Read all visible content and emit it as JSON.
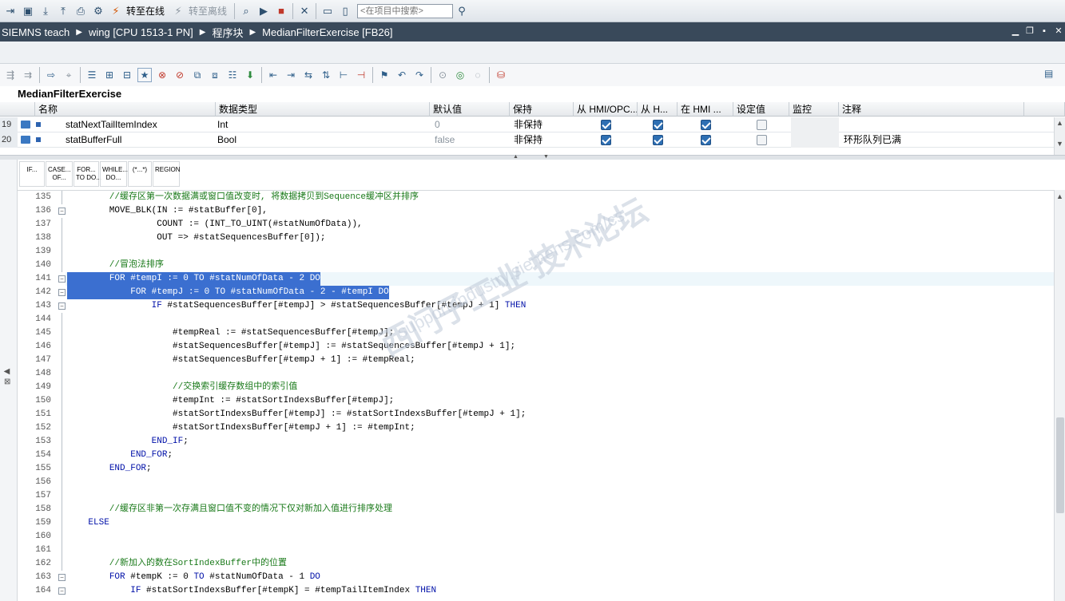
{
  "toolbar": {
    "go_online": "转至在线",
    "go_offline": "转至离线",
    "search_placeholder": "<在项目中搜索>"
  },
  "titlebar": {
    "crumbs": [
      "SIEMNS teach",
      "wing [CPU 1513-1 PN]",
      "程序块",
      "MedianFilterExercise [FB26]"
    ]
  },
  "block": {
    "name": "MedianFilterExercise"
  },
  "interface": {
    "headers": [
      "名称",
      "数据类型",
      "默认值",
      "保持",
      "从 HMI/OPC...",
      "从 H...",
      "在 HMI ...",
      "设定值",
      "监控",
      "注释"
    ],
    "rows": [
      {
        "num": "19",
        "name": "statNextTailItemIndex",
        "type": "Int",
        "default": "0",
        "retain": "非保持",
        "c1": true,
        "c2": true,
        "c3": true,
        "setpoint": false,
        "comment": ""
      },
      {
        "num": "20",
        "name": "statBufferFull",
        "type": "Bool",
        "default": "false",
        "retain": "非保持",
        "c1": true,
        "c2": true,
        "c3": true,
        "setpoint": false,
        "comment": "环形队列已满"
      }
    ]
  },
  "palette": [
    "IF...",
    "CASE...\nOF...",
    "FOR...\nTO DO...",
    "WHILE...\nDO...",
    "(*...*)",
    "REGION"
  ],
  "code": [
    {
      "n": "135",
      "t": "        //缓存区第一次数据满或窗口值改变时, 将数据拷贝到Sequence缓冲区并排序",
      "c": "cm"
    },
    {
      "n": "136",
      "t": "        MOVE_BLK(IN := #statBuffer[0],",
      "fold": true
    },
    {
      "n": "137",
      "t": "                 COUNT := (INT_TO_UINT(#statNumOfData)),"
    },
    {
      "n": "138",
      "t": "                 OUT => #statSequencesBuffer[0]);"
    },
    {
      "n": "139",
      "t": ""
    },
    {
      "n": "140",
      "t": "        //冒泡法排序",
      "c": "cm"
    },
    {
      "n": "141",
      "t": "        FOR #tempI := 0 TO #statNumOfData - 2 DO",
      "sel": true,
      "fold": true
    },
    {
      "n": "142",
      "t": "            FOR #tempJ := 0 TO #statNumOfData - 2 - #tempI DO",
      "sel": true,
      "fold": true
    },
    {
      "n": "143",
      "t": "                IF #statSequencesBuffer[#tempJ] > #statSequencesBuffer[#tempJ + 1] THEN",
      "fold": true
    },
    {
      "n": "144",
      "t": ""
    },
    {
      "n": "145",
      "t": "                    #tempReal := #statSequencesBuffer[#tempJ];"
    },
    {
      "n": "146",
      "t": "                    #statSequencesBuffer[#tempJ] := #statSequencesBuffer[#tempJ + 1];"
    },
    {
      "n": "147",
      "t": "                    #statSequencesBuffer[#tempJ + 1] := #tempReal;"
    },
    {
      "n": "148",
      "t": ""
    },
    {
      "n": "149",
      "t": "                    //交换索引缓存数组中的索引值",
      "c": "cm"
    },
    {
      "n": "150",
      "t": "                    #tempInt := #statSortIndexsBuffer[#tempJ];"
    },
    {
      "n": "151",
      "t": "                    #statSortIndexsBuffer[#tempJ] := #statSortIndexsBuffer[#tempJ + 1];"
    },
    {
      "n": "152",
      "t": "                    #statSortIndexsBuffer[#tempJ + 1] := #tempInt;"
    },
    {
      "n": "153",
      "t": "                END_IF;"
    },
    {
      "n": "154",
      "t": "            END_FOR;"
    },
    {
      "n": "155",
      "t": "        END_FOR;"
    },
    {
      "n": "156",
      "t": ""
    },
    {
      "n": "157",
      "t": ""
    },
    {
      "n": "158",
      "t": "        //缓存区非第一次存满且窗口值不变的情况下仅对新加入值进行排序处理",
      "c": "cm"
    },
    {
      "n": "159",
      "t": "    ELSE"
    },
    {
      "n": "160",
      "t": ""
    },
    {
      "n": "161",
      "t": ""
    },
    {
      "n": "162",
      "t": "        //新加入的数在SortIndexBuffer中的位置",
      "c": "cm"
    },
    {
      "n": "163",
      "t": "        FOR #tempK := 0 TO #statNumOfData - 1 DO",
      "fold": true
    },
    {
      "n": "164",
      "t": "            IF #statSortIndexsBuffer[#tempK] = #tempTailItemIndex THEN",
      "fold": true
    }
  ],
  "watermark": {
    "main": "西门子工业 技术论坛",
    "sub": "support.industry.siemens.com/cs"
  },
  "colors": {
    "titlebar": "#39495a",
    "selection": "#3b6fd0",
    "comment": "#1a7a1a",
    "keyword": "#0010a8"
  }
}
